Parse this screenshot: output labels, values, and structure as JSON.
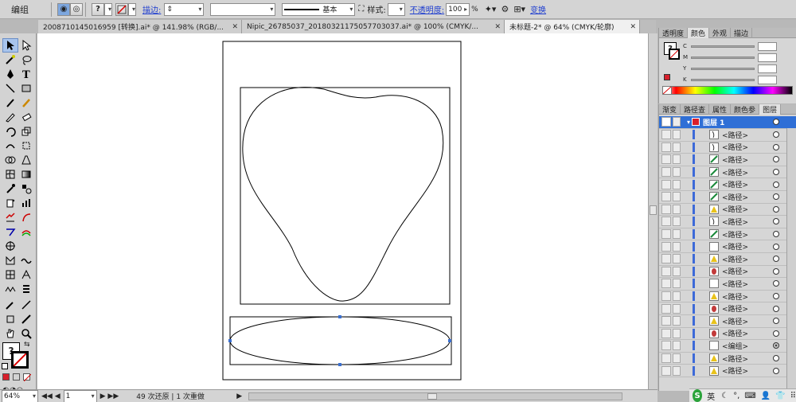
{
  "controlbar": {
    "mode_label": "编组",
    "stroke_label": "描边:",
    "stroke_style": "基本",
    "style_label": "样式:",
    "opacity_label": "不透明度:",
    "opacity_value": "100",
    "opacity_unit": "%",
    "transform_label": "变换"
  },
  "tabs": [
    {
      "label": "2008710145016959 [转换].ai* @ 141.98% (RGB/..."
    },
    {
      "label": "Nipic_26785037_20180321175057703037.ai* @ 100% (CMYK/..."
    },
    {
      "label": "未标题-2* @ 64% (CMYK/轮廓)"
    }
  ],
  "color_panel": {
    "tabs": [
      "透明度",
      "颜色",
      "外观",
      "描边"
    ],
    "channels": [
      "C",
      "M",
      "Y",
      "K"
    ]
  },
  "layers_panel": {
    "tabs": [
      "渐变",
      "路径查",
      "属性",
      "颜色参",
      "图层"
    ],
    "layer_name": "图层 1",
    "items": [
      {
        "name": "<路径>"
      },
      {
        "name": "<路径>"
      },
      {
        "name": "<路径>"
      },
      {
        "name": "<路径>"
      },
      {
        "name": "<路径>"
      },
      {
        "name": "<路径>"
      },
      {
        "name": "<路径>"
      },
      {
        "name": "<路径>"
      },
      {
        "name": "<路径>"
      },
      {
        "name": "<路径>"
      },
      {
        "name": "<路径>"
      },
      {
        "name": "<路径>"
      },
      {
        "name": "<路径>"
      },
      {
        "name": "<路径>"
      },
      {
        "name": "<路径>"
      },
      {
        "name": "<路径>"
      },
      {
        "name": "<路径>"
      },
      {
        "name": "<编组>"
      },
      {
        "name": "<路径>"
      },
      {
        "name": "<路径>"
      }
    ]
  },
  "statusbar": {
    "zoom": "64%",
    "artboard": "1",
    "status_text": "49 次还原 | 1 次重做"
  },
  "taskbar": {
    "ime_label": "英"
  }
}
